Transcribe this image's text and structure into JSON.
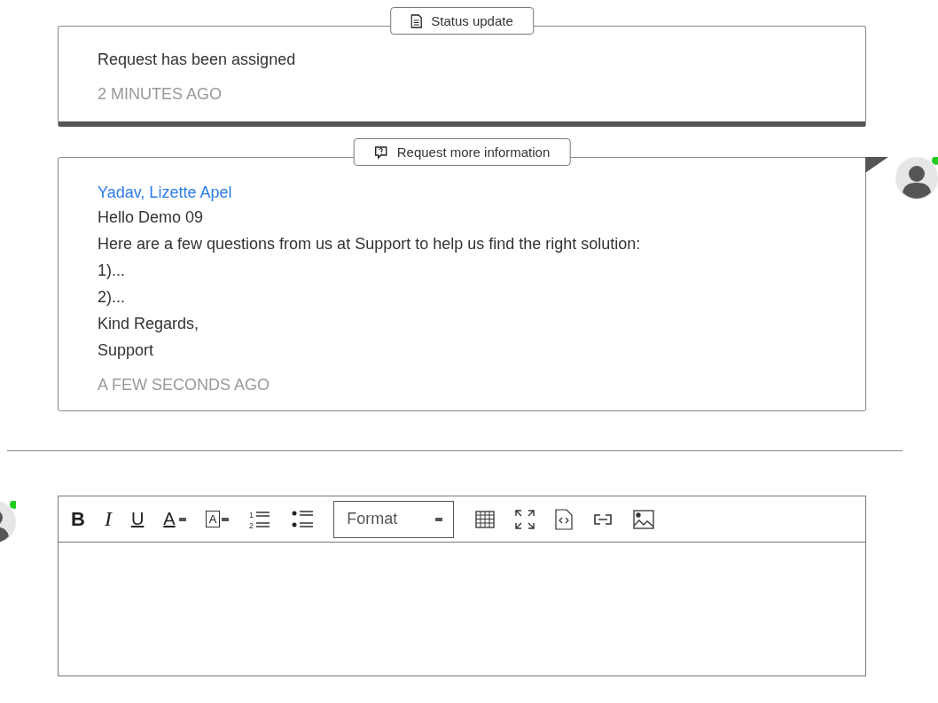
{
  "timeline": [
    {
      "kind": "status",
      "label": "Status update",
      "lines": [
        "Request has been assigned"
      ],
      "time": "2 MINUTES AGO"
    },
    {
      "kind": "request",
      "label": "Request more information",
      "author": "Yadav, Lizette Apel",
      "lines": [
        "Hello Demo 09",
        "Here are a few questions from us at Support to help us find the right solution:",
        "1)...",
        "2)...",
        "Kind Regards,",
        "Support"
      ],
      "time": "A FEW SECONDS AGO",
      "avatar": {
        "online": true
      }
    }
  ],
  "composer": {
    "avatar": {
      "online": true
    },
    "toolbar": [
      {
        "kind": "bold",
        "glyph": "B"
      },
      {
        "kind": "italic",
        "glyph": "I"
      },
      {
        "kind": "underline",
        "glyph": "U"
      },
      {
        "kind": "font-color",
        "glyph": "A"
      },
      {
        "kind": "highlight",
        "glyph": "A"
      },
      {
        "kind": "numbered-list",
        "glyph": "1",
        "glyph2": "2"
      },
      {
        "kind": "bulleted-list"
      },
      {
        "kind": "format",
        "label": "Format"
      },
      {
        "kind": "table"
      },
      {
        "kind": "fullscreen"
      },
      {
        "kind": "source"
      },
      {
        "kind": "link"
      },
      {
        "kind": "image"
      }
    ]
  }
}
